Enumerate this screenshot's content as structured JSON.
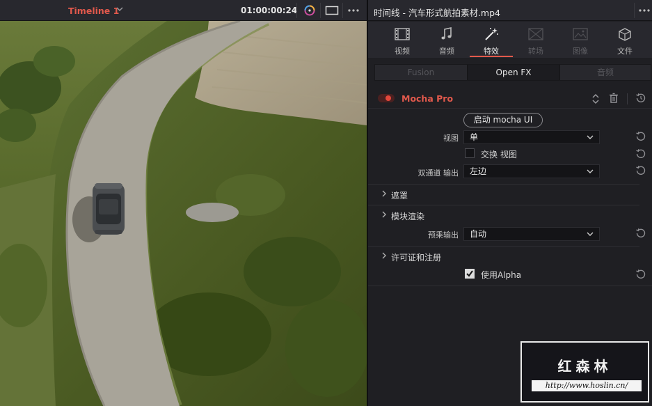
{
  "viewer": {
    "timeline_name": "Timeline 1",
    "timecode": "01:00:00:24"
  },
  "inspector": {
    "clip_title": "时间线 - 汽车形式航拍素材.mp4",
    "tabs": [
      {
        "label": "视频",
        "icon": "film-icon",
        "state": "normal"
      },
      {
        "label": "音频",
        "icon": "music-note-icon",
        "state": "normal"
      },
      {
        "label": "特效",
        "icon": "magic-wand-icon",
        "state": "active"
      },
      {
        "label": "转场",
        "icon": "transition-icon",
        "state": "disabled"
      },
      {
        "label": "图像",
        "icon": "image-icon",
        "state": "disabled"
      },
      {
        "label": "文件",
        "icon": "file-cube-icon",
        "state": "normal"
      }
    ],
    "subtabs": [
      {
        "label": "Fusion",
        "state": "disabled"
      },
      {
        "label": "Open FX",
        "state": "active"
      },
      {
        "label": "音频",
        "state": "disabled"
      }
    ],
    "effect": {
      "name": "Mocha Pro",
      "enabled": true,
      "launch_button": "启动 mocha UI",
      "params": {
        "view_label": "视图",
        "view_value": "单",
        "swap_view_label": "交换 视图",
        "swap_view_checked": false,
        "dual_output_label": "双通道 输出",
        "dual_output_value": "左边",
        "render_prefix_label": "预乘输出",
        "render_prefix_value": "自动",
        "use_alpha_label": "使用Alpha",
        "use_alpha_checked": true
      },
      "sections": {
        "mask": "遮罩",
        "module_render": "模块渲染",
        "license": "许可证和注册"
      }
    }
  },
  "watermark": {
    "title": "红森林",
    "url": "http://www.hoslin.cn/"
  },
  "colors": {
    "accent_red": "#e2594c",
    "panel_bg": "#1f1f23",
    "header_bg": "#28282e"
  }
}
